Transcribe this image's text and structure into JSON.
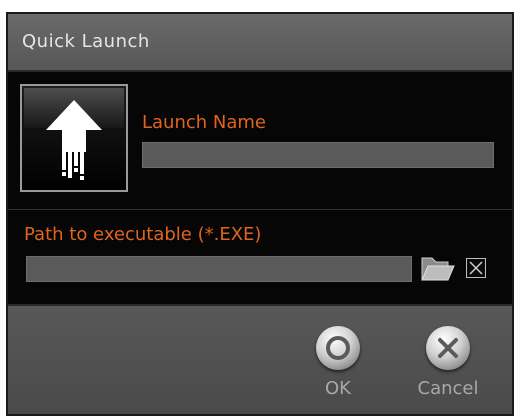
{
  "window": {
    "title": "Quick Launch"
  },
  "launch": {
    "label": "Launch Name",
    "value": ""
  },
  "path": {
    "label": "Path to executable (*.EXE)",
    "value": ""
  },
  "icons": {
    "app": "upload-arrow-icon",
    "browse": "folder-icon",
    "clear": "close-icon",
    "ok": "circle-icon",
    "cancel": "cross-icon"
  },
  "buttons": {
    "ok_label": "OK",
    "cancel_label": "Cancel"
  },
  "colors": {
    "accent": "#e0641e",
    "panel_dark": "#060606",
    "frame": "#4a4a4a",
    "input_bg": "#5a5a5a",
    "button_text": "#a8a8a8"
  }
}
